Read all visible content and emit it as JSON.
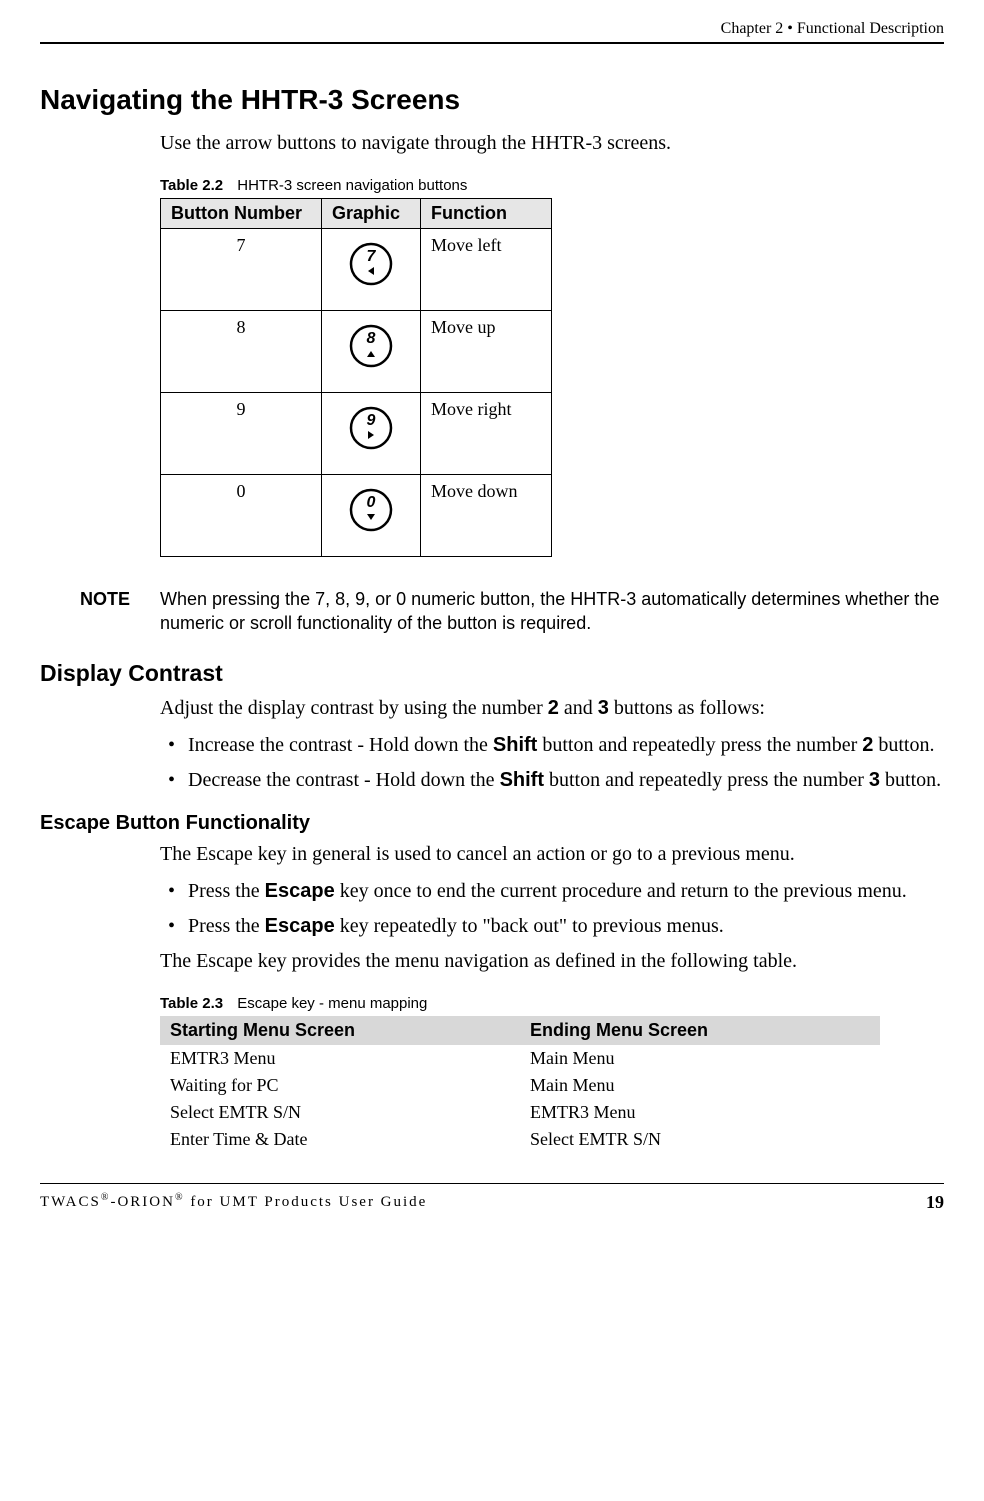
{
  "header": {
    "chapter": "Chapter 2 • Functional Description"
  },
  "section1": {
    "title": "Navigating the HHTR-3 Screens",
    "intro": "Use the arrow buttons to navigate through the HHTR-3 screens."
  },
  "table22": {
    "number": "Table 2.2",
    "caption": "HHTR-3 screen navigation buttons",
    "headers": {
      "c1": "Button Number",
      "c2": "Graphic",
      "c3": "Function"
    },
    "rows": [
      {
        "num": "7",
        "digit": "7",
        "arrow": "left",
        "func": "Move left"
      },
      {
        "num": "8",
        "digit": "8",
        "arrow": "up",
        "func": "Move up"
      },
      {
        "num": "9",
        "digit": "9",
        "arrow": "right",
        "func": "Move right"
      },
      {
        "num": "0",
        "digit": "0",
        "arrow": "down",
        "func": "Move down"
      }
    ]
  },
  "note": {
    "label": "NOTE",
    "text": "When pressing the 7, 8, 9, or 0 numeric button, the HHTR-3 automatically determines whether the numeric or scroll functionality of the button is required."
  },
  "contrast": {
    "title": "Display Contrast",
    "intro_before": "Adjust the display contrast by using the number ",
    "b2": "2",
    "intro_mid": " and ",
    "b3": "3",
    "intro_after": " buttons as follows:",
    "li1_a": "Increase the contrast - Hold down the ",
    "li1_shift": "Shift",
    "li1_b": " button and repeatedly press the number ",
    "li1_num": "2",
    "li1_c": " button.",
    "li2_a": "Decrease the contrast - Hold down the ",
    "li2_shift": "Shift",
    "li2_b": " button and repeatedly press the number ",
    "li2_num": "3",
    "li2_c": " button."
  },
  "escape": {
    "title": "Escape Button Functionality",
    "intro": "The Escape key in general is used to cancel an action or go to a previous menu.",
    "li1_a": "Press the ",
    "li1_esc": "Escape",
    "li1_b": " key once to end the current procedure and return to the previous menu.",
    "li2_a": "Press the ",
    "li2_esc": "Escape",
    "li2_b": " key repeatedly to \"back out\" to previous menus.",
    "outro": "The Escape key provides the menu navigation as defined in the following table."
  },
  "table23": {
    "number": "Table 2.3",
    "caption": "Escape key - menu mapping",
    "headers": {
      "c1": "Starting Menu Screen",
      "c2": "Ending Menu Screen"
    },
    "rows": [
      {
        "start": "EMTR3 Menu",
        "end": "Main Menu"
      },
      {
        "start": "Waiting for PC",
        "end": "Main Menu"
      },
      {
        "start": "Select EMTR S/N",
        "end": "EMTR3 Menu"
      },
      {
        "start": "Enter Time & Date",
        "end": "Select EMTR S/N"
      }
    ]
  },
  "footer": {
    "left_a": "TWACS",
    "left_b": "-ORION",
    "left_c": " for UMT Products User Guide",
    "page": "19"
  }
}
